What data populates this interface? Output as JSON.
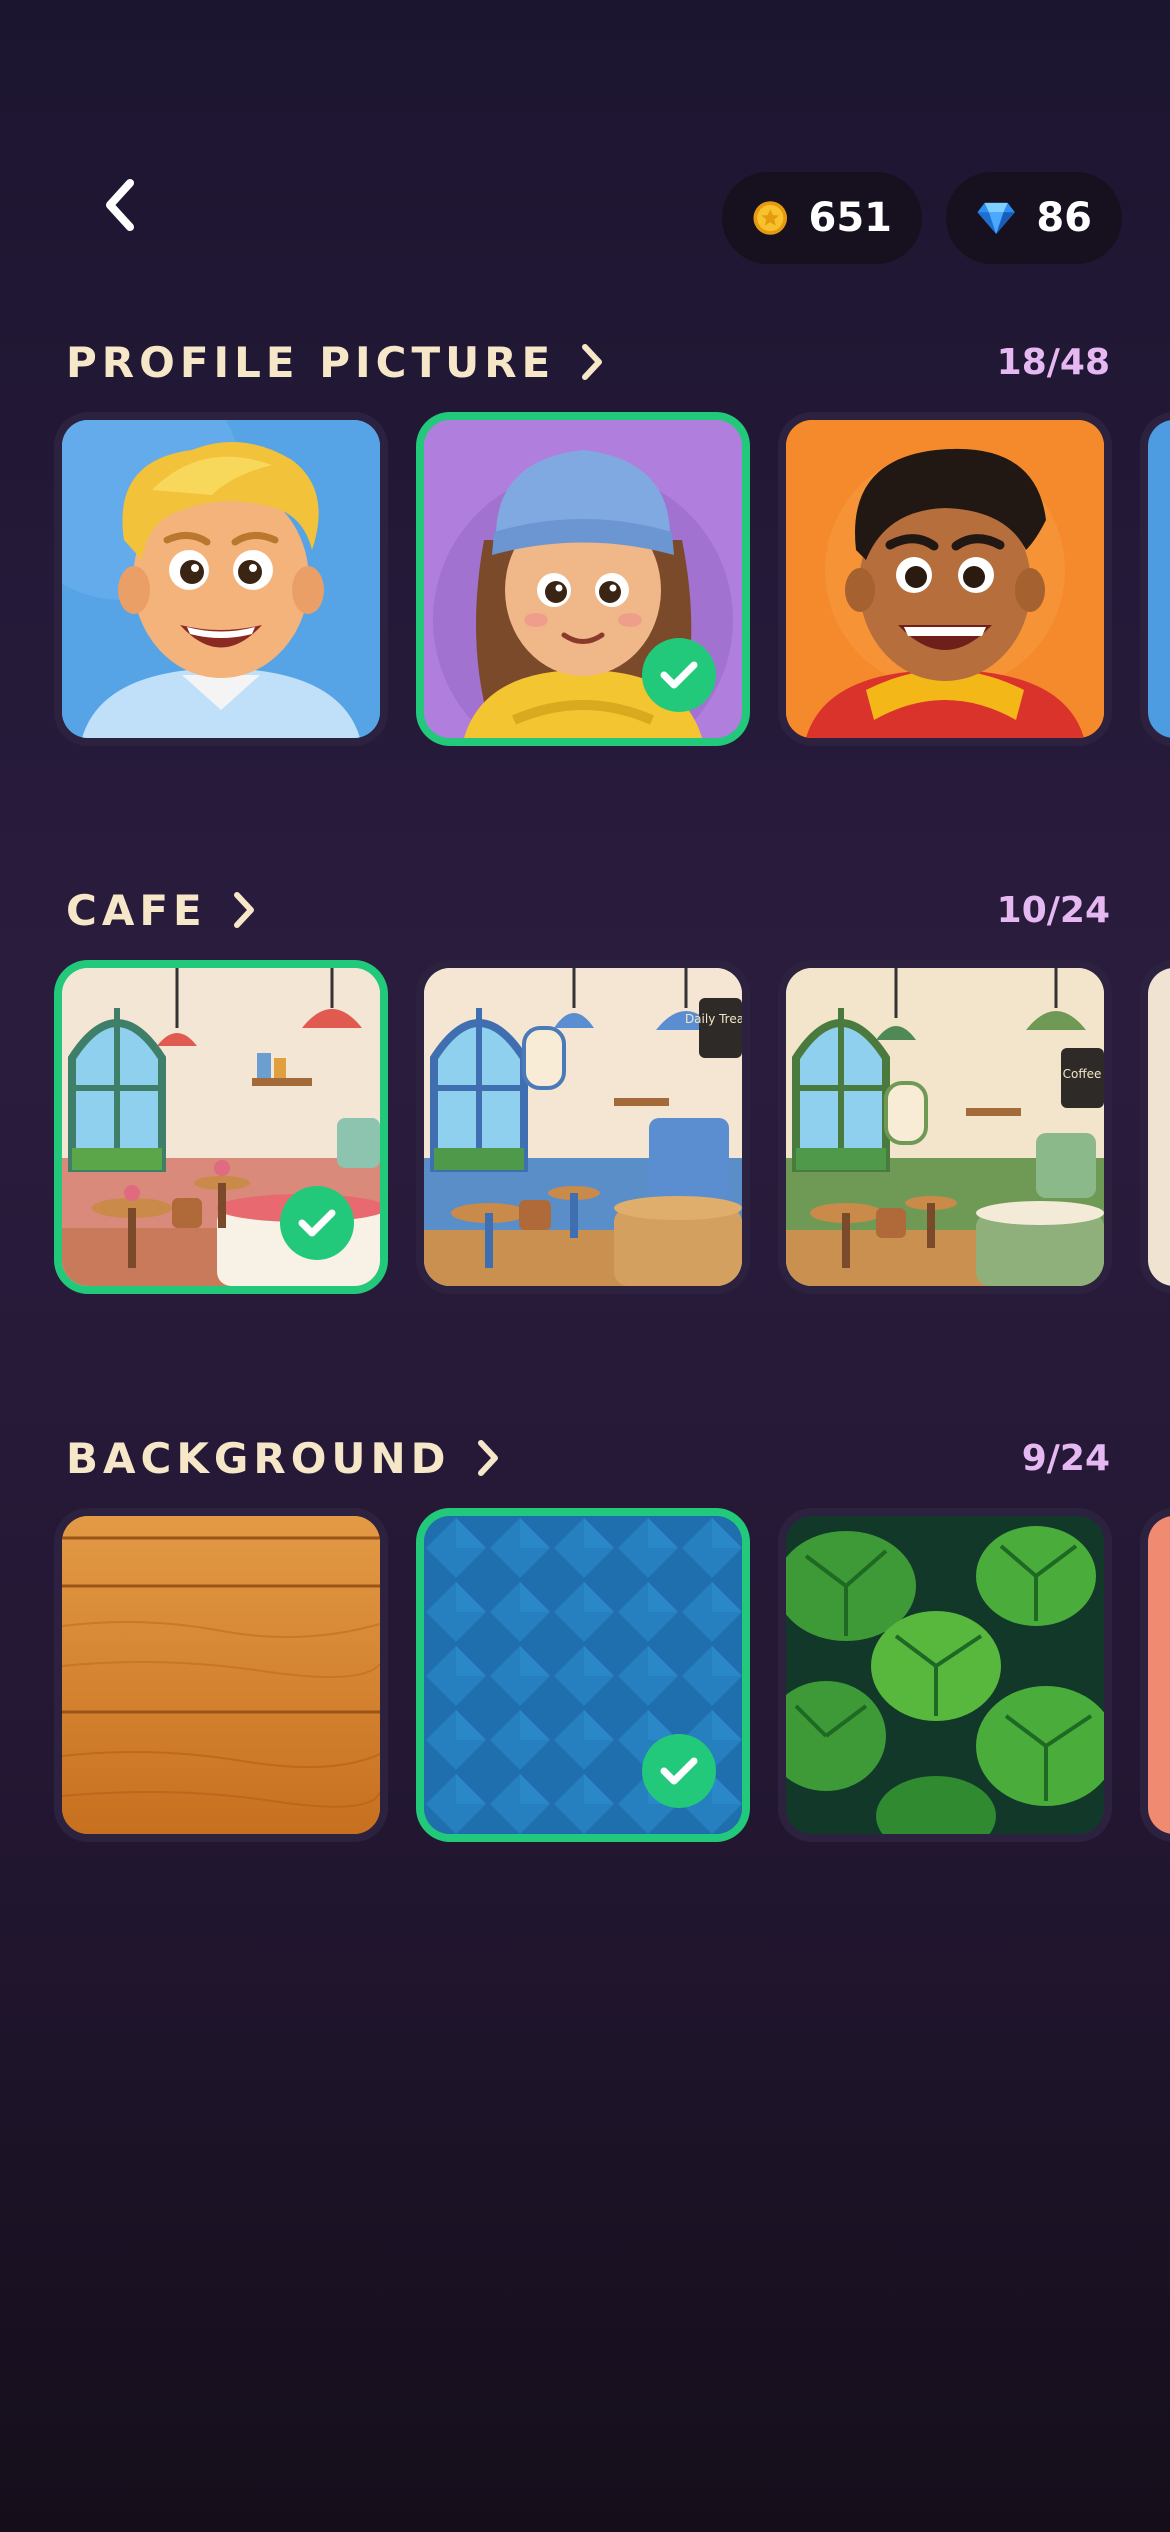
{
  "header": {
    "coins": "651",
    "gems": "86"
  },
  "colors": {
    "accent": "#22c97a",
    "title": "#f6e7c8",
    "count": "#e6b8f2"
  },
  "sections": [
    {
      "title": "PROFILE PICTURE",
      "count": "18/48",
      "items": [
        {
          "name": "blond-boy-avatar",
          "selected": false
        },
        {
          "name": "girl-beanie-avatar",
          "selected": true
        },
        {
          "name": "dark-hair-boy-avatar",
          "selected": false
        }
      ]
    },
    {
      "title": "CAFE",
      "count": "10/24",
      "items": [
        {
          "name": "pink-cafe",
          "selected": true
        },
        {
          "name": "blue-cafe",
          "selected": false,
          "sign_text": "Daily Treats"
        },
        {
          "name": "green-cafe",
          "selected": false,
          "sign_text": "Coffee"
        }
      ]
    },
    {
      "title": "BACKGROUND",
      "count": "9/24",
      "items": [
        {
          "name": "wood-background",
          "selected": false
        },
        {
          "name": "blue-diamond-background",
          "selected": true
        },
        {
          "name": "jungle-leaves-background",
          "selected": false
        }
      ]
    }
  ]
}
